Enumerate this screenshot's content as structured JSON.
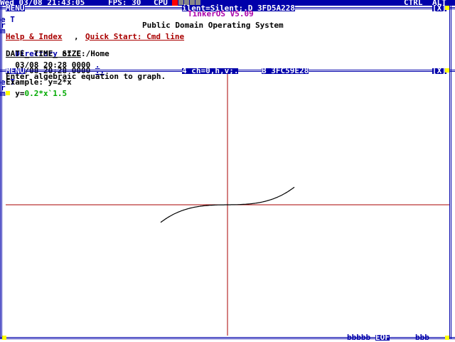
{
  "topbar": {
    "clock": "Wed 03/08 21:43:05",
    "fps": "FPS: 30",
    "cpu": "CPU",
    "task_title": "ilent=Silent;.D 3FD5A228",
    "ctrl": "CTRL",
    "alt": "ALT",
    "close": "[X]"
  },
  "term_side_label": [
    "T",
    "e",
    "r",
    "m"
  ],
  "term_window": {
    "menu": "MENU",
    "os_name": "TinkerOS V5.09",
    "subtitle": "Public Domain Operating System",
    "help_link": "Help & Index",
    "sep": ",",
    "quickstart_link": "Quick Start: Cmd line",
    "dir_link": "Directory",
    "dir_rest": " of C:/Home",
    "columns": "DATE_ TIME_ SIZE",
    "rows": [
      {
        "text": "03/08 20:28 0000",
        "link": "."
      },
      {
        "text": "03/08 20:28 0000",
        "link": ".."
      }
    ]
  },
  "graph_window": {
    "menu": "MENU",
    "title_left": "4 ch=0,h,v;.",
    "title_right": "B 3FC59E28",
    "close": "[X]",
    "side_label": [
      "T",
      "e",
      "r",
      "m"
    ],
    "prompt1": "Enter algebraic equation to graph.",
    "prompt2": "Example: y=2*x",
    "input_prefix": "y=",
    "input_value": "0.2*x`1.5",
    "status_dots_left": "bbbbb",
    "eof": "EOF",
    "status_dots_right": "bbb"
  },
  "colors": {
    "frame": "#0000aa",
    "axes": "#aa0000",
    "curve": "#000000",
    "title_purple": "#aa00aa",
    "link_red": "#aa0000",
    "input_green": "#00aa00"
  }
}
